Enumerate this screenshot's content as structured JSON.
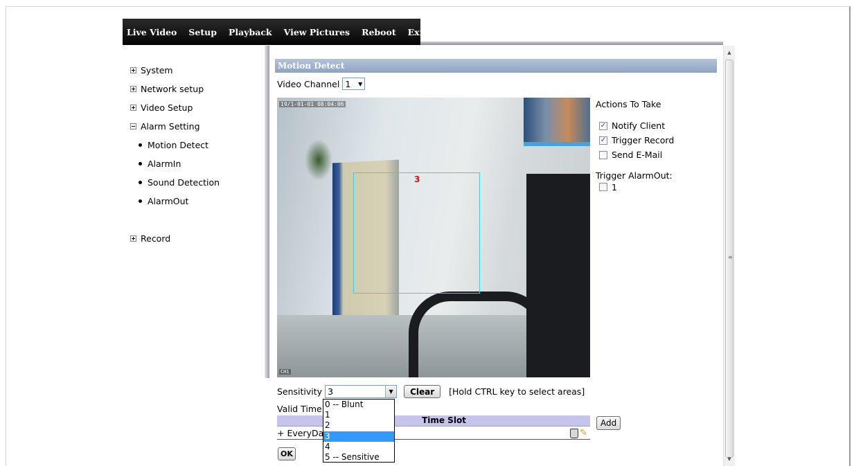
{
  "nav": {
    "items": [
      "Live Video",
      "Setup",
      "Playback",
      "View Pictures",
      "Reboot",
      "Exit"
    ]
  },
  "sidebar": {
    "system": "System",
    "network": "Network setup",
    "video": "Video Setup",
    "alarm": "Alarm Setting",
    "alarm_children": [
      "Motion Detect",
      "AlarmIn",
      "Sound Detection",
      "AlarmOut"
    ],
    "record": "Record"
  },
  "panel": {
    "title": "Motion Detect",
    "channel_label": "Video Channel",
    "channel_value": "1",
    "timestamp": "19/1-01-01 08:04:06",
    "corner_label": "CH1",
    "area_number": "3"
  },
  "actions": {
    "title": "Actions To Take",
    "notify_client": "Notify Client",
    "notify_client_checked": true,
    "trigger_record": "Trigger Record",
    "trigger_record_checked": true,
    "send_email": "Send E-Mail",
    "send_email_checked": false,
    "trigger_alarmout": "Trigger AlarmOut:",
    "alarmout_1": "1",
    "alarmout_1_checked": false
  },
  "controls": {
    "sensitivity_label": "Sensitivity",
    "sensitivity_value": "3",
    "sensitivity_options": [
      "0 -- Blunt",
      "1",
      "2",
      "3",
      "4",
      "5 -- Sensitive"
    ],
    "sensitivity_selected_index": 3,
    "clear_label": "Clear",
    "hint": "[Hold CTRL key to select areas]",
    "valid_time_label": "Valid Time",
    "timeslot_header": "Time Slot",
    "timeslot_row": "+ EveryDay",
    "add_label": "Add",
    "ok_label": "OK"
  },
  "icons": {
    "trash": "trash-icon",
    "pencil": "pencil-icon"
  },
  "colors": {
    "panel_header": "#8fa3c0",
    "motion_area": "#33d6d6",
    "area_label": "#e01010",
    "dropdown_selected": "#3399ff",
    "timeslot_header": "#c6c3ec"
  }
}
